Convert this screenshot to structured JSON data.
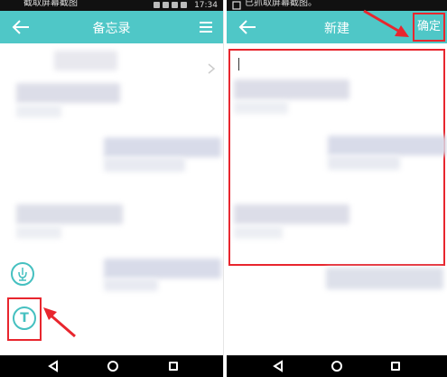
{
  "left": {
    "status_text": "截取屏幕截图",
    "status_time": "17:34",
    "title": "备忘录",
    "add_text_glyph": "T"
  },
  "right": {
    "status_text": "已抓取屏幕截图。",
    "title": "新建",
    "confirm_label": "确定"
  },
  "colors": {
    "accent": "#4fc7c7",
    "highlight": "#e8262e"
  }
}
